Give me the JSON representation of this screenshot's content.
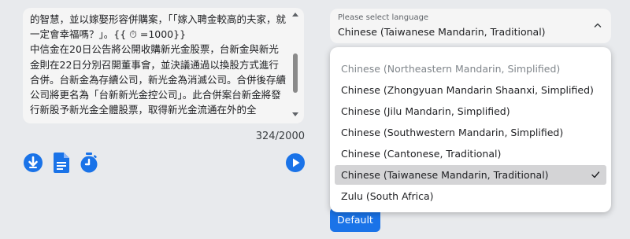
{
  "text_panel": {
    "content": "的智慧，並以嫁娶形容併購案，「「嫁入聘金較高的夫家，就一定會幸福嗎？」。{{ ⏱ =1000}}\n中信金在20日公告將公開收購新光金股票，台新金與新光金則在22日分別召開董事會，並決議通過以換股方式進行合併。台新金為存續公司，新光金為消滅公司。合併後存續公司將更名為「台新新光金控公司」。此合併案台新金將發行新股予新光金全體股票，取得新光金流通在外的全",
    "char_count": "324/2000"
  },
  "icons": {
    "download": "download-icon",
    "document": "document-icon",
    "timer": "timer-icon",
    "play": "play-icon"
  },
  "language": {
    "caption": "Please select language",
    "selected": "Chinese (Taiwanese Mandarin, Traditional)",
    "options": [
      "Chinese (Northeastern Mandarin, Simplified)",
      "Chinese (Zhongyuan Mandarin Shaanxi, Simplified)",
      "Chinese (Jilu Mandarin, Simplified)",
      "Chinese (Southwestern Mandarin, Simplified)",
      "Chinese (Cantonese, Traditional)",
      "Chinese (Taiwanese Mandarin, Traditional)",
      "Zulu (South Africa)"
    ]
  },
  "default_button": "Default",
  "colors": {
    "accent": "#1a73e8",
    "background": "#e8eaed",
    "panel": "#f5f5f5",
    "selected_row": "#d4d4d6"
  }
}
